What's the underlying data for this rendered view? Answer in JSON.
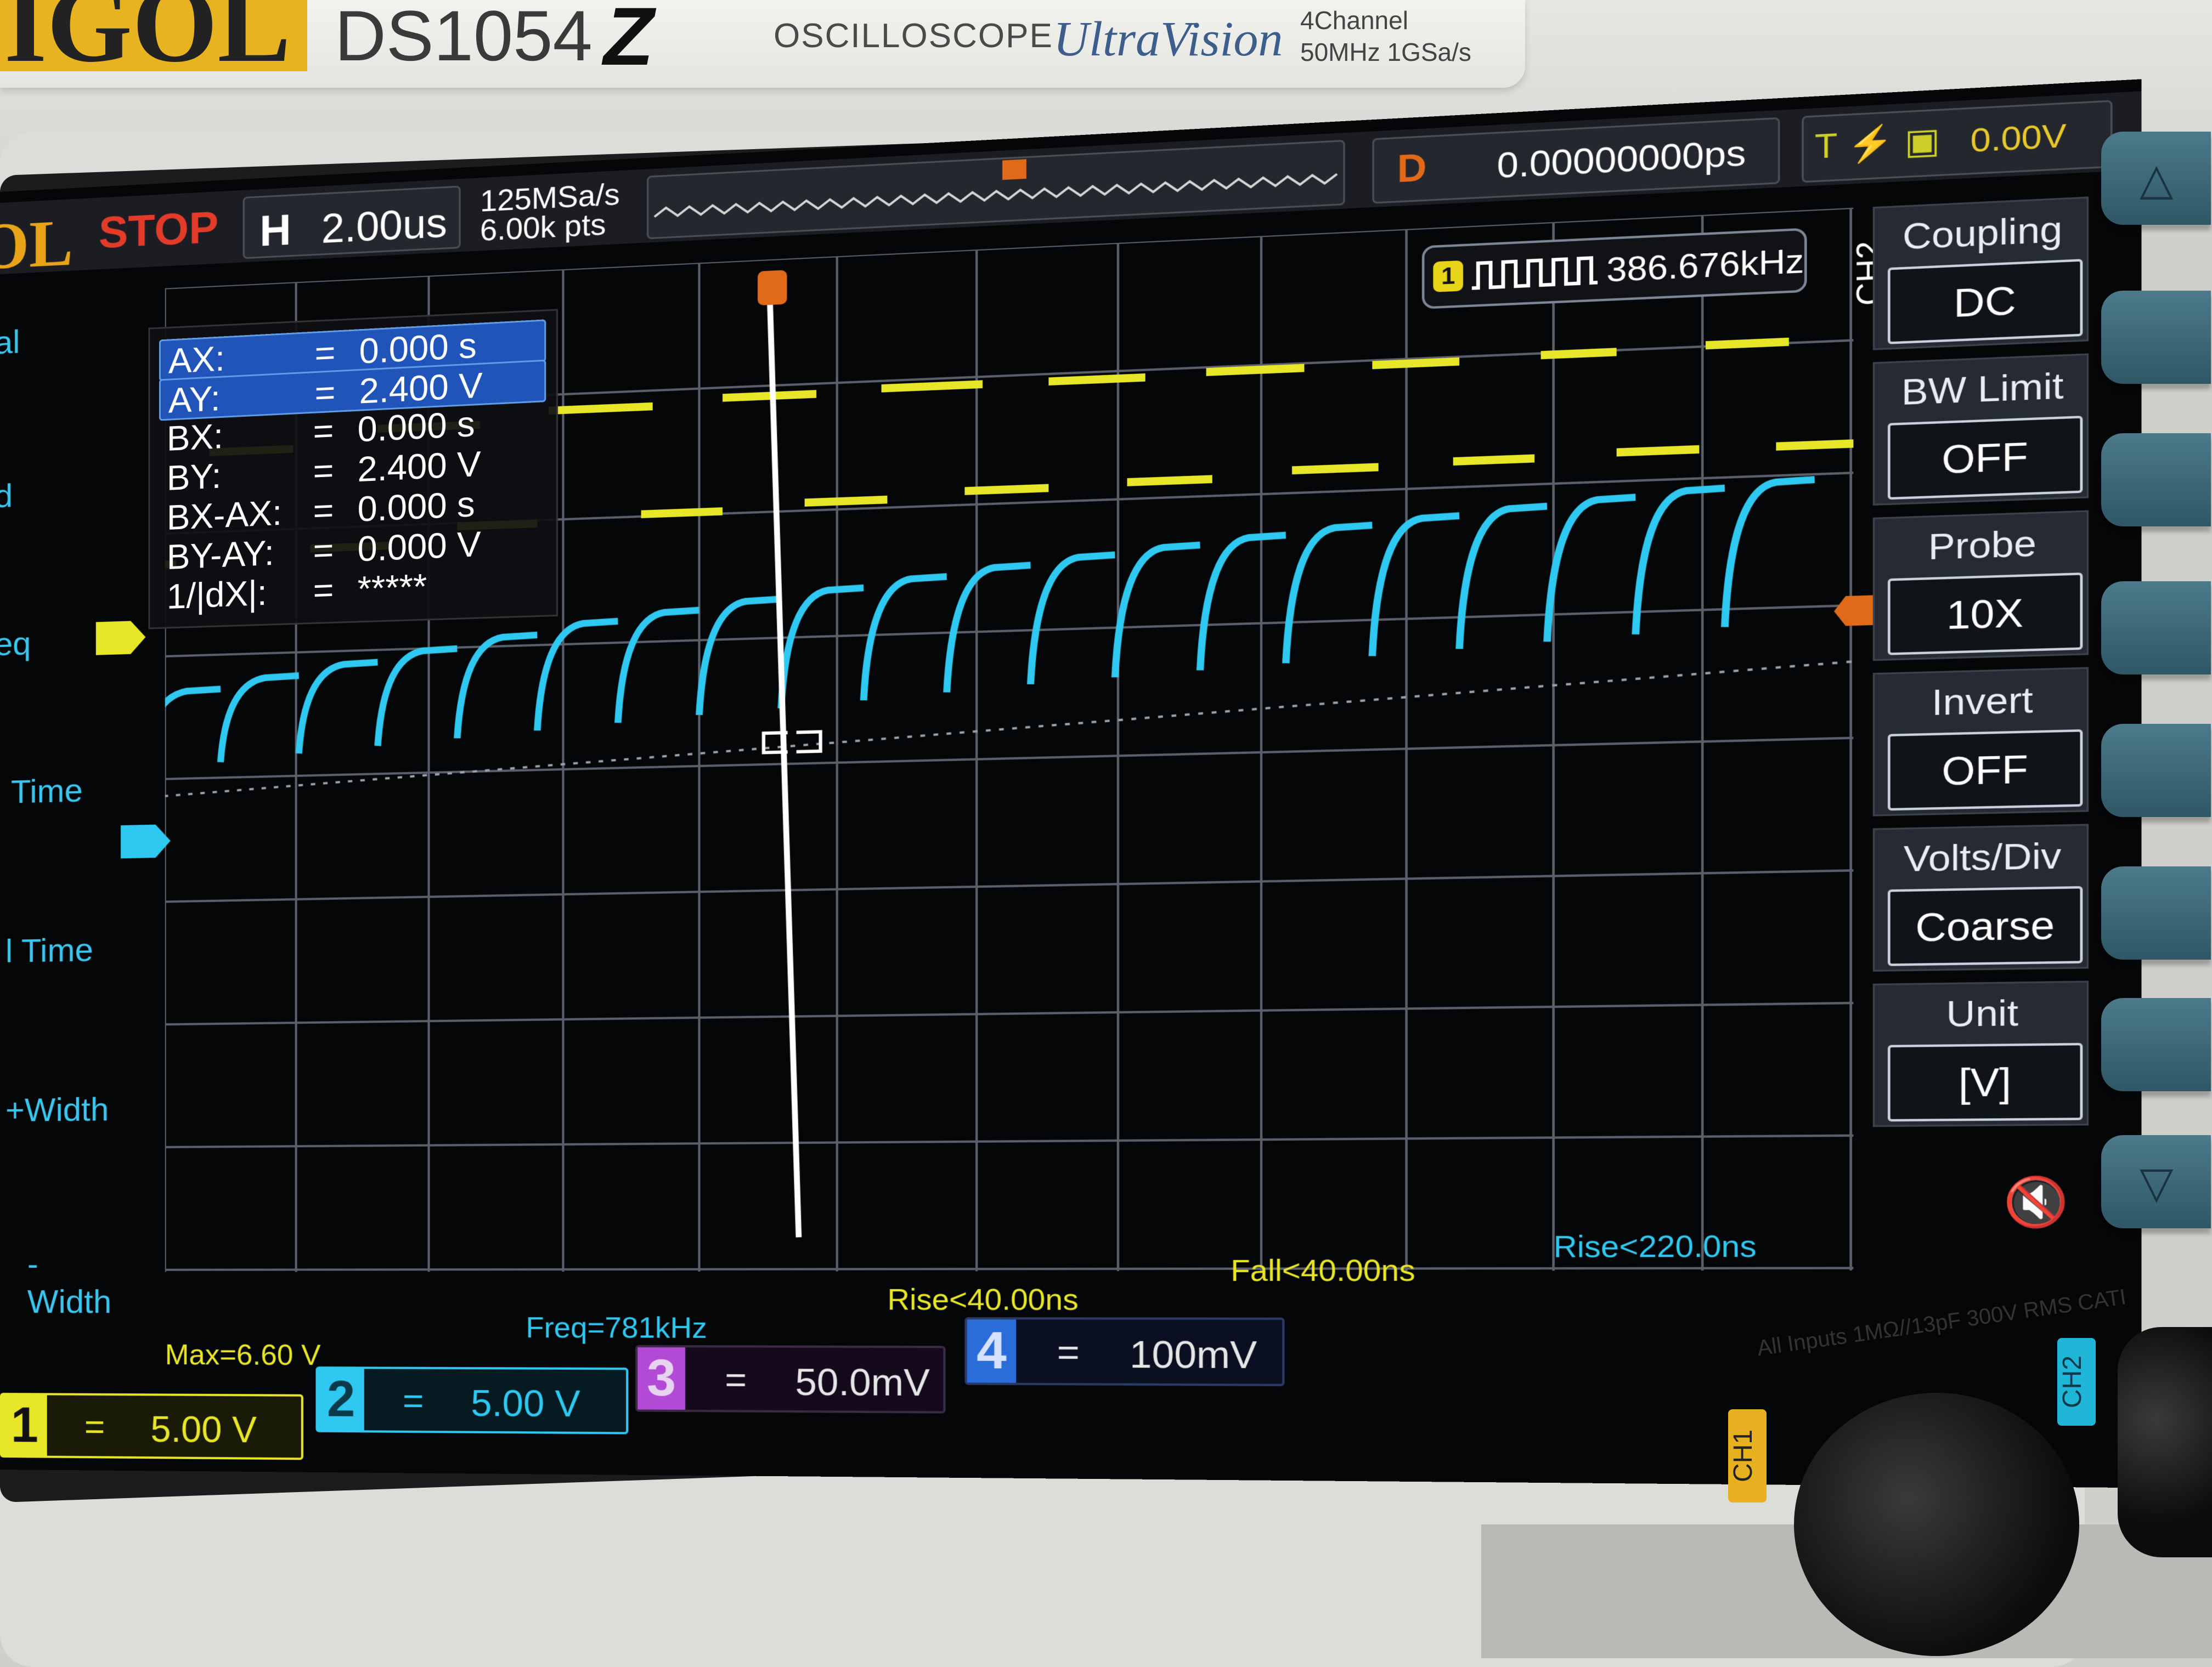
{
  "brand": {
    "logo": "IGOL",
    "model": "DS1054",
    "model_suffix": "Z",
    "product": "OSCILLOSCOPE",
    "series": "UltraVision",
    "spec_line1": "4Channel",
    "spec_line2": "50MHz  1GSa/s"
  },
  "topbar": {
    "logo": "OL",
    "run_state": "STOP",
    "h_label": "H",
    "timebase": "2.00us",
    "sample_rate": "125MSa/s",
    "memory": "6.00k pts",
    "delay_label": "D",
    "delay": "0.00000000ps",
    "trigger_type": "T",
    "trigger_level": "0.00V"
  },
  "cursors": {
    "rows": [
      {
        "key": "AX:",
        "eq": "=",
        "value": "0.000 s"
      },
      {
        "key": "AY:",
        "eq": "=",
        "value": "2.400 V"
      },
      {
        "key": "BX:",
        "eq": "=",
        "value": "0.000 s"
      },
      {
        "key": "BY:",
        "eq": "=",
        "value": "2.400 V"
      },
      {
        "key": "BX-AX:",
        "eq": "=",
        "value": "0.000 s"
      },
      {
        "key": "BY-AY:",
        "eq": "=",
        "value": "0.000 V"
      },
      {
        "key": "1/|dX|:",
        "eq": "=",
        "value": "*****"
      }
    ]
  },
  "frequency_counter": {
    "channel": "1",
    "value": "386.676kHz"
  },
  "menu": {
    "channel": "CH2",
    "items": [
      {
        "title": "Coupling",
        "value": "DC"
      },
      {
        "title": "BW Limit",
        "value": "OFF"
      },
      {
        "title": "Probe",
        "value": "10X"
      },
      {
        "title": "Invert",
        "value": "OFF"
      },
      {
        "title": "Volts/Div",
        "value": "Coarse"
      },
      {
        "title": "Unit",
        "value": "[V]"
      }
    ]
  },
  "left_menu": [
    "al",
    "d",
    "eq",
    "Time",
    "l Time",
    "+Width",
    "-Width"
  ],
  "measurements": {
    "max": "Max=6.60 V",
    "freq": "Freq=781kHz",
    "rise1": "Rise<40.00ns",
    "fall": "Fall<40.00ns",
    "rise2": "Rise<220.0ns"
  },
  "channels": [
    {
      "num": "1",
      "eq": "=",
      "scale": "5.00 V",
      "color": "#e8e628"
    },
    {
      "num": "2",
      "eq": "=",
      "scale": "5.00 V",
      "color": "#2ec8f0"
    },
    {
      "num": "3",
      "eq": "=",
      "scale": "50.0mV",
      "color": "#b24ad6"
    },
    {
      "num": "4",
      "eq": "=",
      "scale": "100mV",
      "color": "#2a6cd8"
    }
  ],
  "front_panel": {
    "input_spec": "All Inputs 1MΩ//13pF 300V RMS  CATI",
    "ch1": "CH1",
    "ch2": "CH2"
  },
  "colors": {
    "ch1": "#e8e628",
    "ch2": "#2ec8f0",
    "grid": "#5a5f6b",
    "cursor_line": "#ffffff"
  }
}
